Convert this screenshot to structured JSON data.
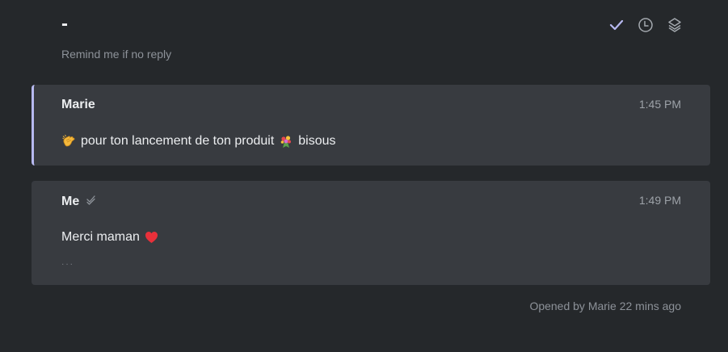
{
  "thread": {
    "title": "-",
    "remind_label": "Remind me if no reply"
  },
  "toolbar": {
    "icons": [
      "check-icon",
      "clock-icon",
      "layers-icon"
    ]
  },
  "messages": [
    {
      "sender": "Marie",
      "time": "1:45 PM",
      "emoji_before": "clapping-hands-emoji",
      "text": "pour ton lancement de ton produit",
      "emoji_after": "bouquet-emoji",
      "text_after": "bisous"
    },
    {
      "sender": "Me",
      "sender_icon": "double-check-icon",
      "time": "1:49 PM",
      "text": "Merci maman",
      "emoji_after": "red-heart-emoji",
      "ellipsis": "..."
    }
  ],
  "footer": {
    "status": "Opened by Marie 22 mins ago"
  },
  "colors": {
    "background": "#25282b",
    "card": "#383b40",
    "accent": "#b7b9f0",
    "check": "#b7b9f0"
  }
}
